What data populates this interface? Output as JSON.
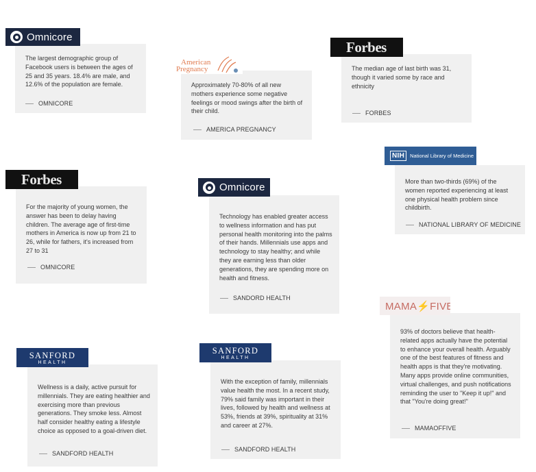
{
  "cards": [
    {
      "logo": "Omnicore",
      "text": "The largest demographic group of Facebook users is between the ages of 25 and 35 years. 18.4% are male, and 12.6% of the population are female.",
      "source": "OMNICORE"
    },
    {
      "logo_line1": "American",
      "logo_line2": "Pregnancy",
      "text": "Approximately 70-80% of all new mothers experience some negative feelings or mood swings after the birth of their child.",
      "source": "AMERICA PREGNANCY"
    },
    {
      "logo": "Forbes",
      "text": "The median age of last birth was 31, though it varied some by race and ethnicity",
      "source": "FORBES"
    },
    {
      "logo": "Forbes",
      "text": "For the majority of young women, the answer has been to delay having children. The average age of first-time mothers in America is now up from 21 to 26, while for fathers, it's increased from 27 to 31",
      "source": "OMNICORE"
    },
    {
      "logo": "Omnicore",
      "text": "Technology has enabled greater access to wellness information and has put personal health monitoring into the palms of their hands. Millennials use apps and technology to stay healthy; and while they are earning less than older generations, they are spending more on health and fitness.",
      "source": "SANDORD HEALTH"
    },
    {
      "logo_box": "NIH",
      "logo_text": "National Library of Medicine",
      "text": "More than two-thirds (69%) of the women reported experiencing at least one physical health problem since childbirth.",
      "source": "NATIONAL LIBRARY OF MEDICINE"
    },
    {
      "logo_line1": "SANFORD",
      "logo_line2": "HEALTH",
      "text": "Wellness is a daily, active pursuit for millennials. They are eating healthier and exercising more than previous generations. They smoke less. Almost half consider healthy eating a lifestyle choice as opposed to a goal-driven diet.",
      "source": "SANDFORD HEALTH"
    },
    {
      "logo_line1": "SANFORD",
      "logo_line2": "HEALTH",
      "text": "With the exception of family, millennials value health the most. In a recent study, 79% said family was important in their lives, followed by health and wellness at 53%, friends at 39%, spirituality at 31% and career at 27%.",
      "source": "SANDFORD HEALTH"
    },
    {
      "logo": "MAMA⚡FIVE",
      "text": "93% of doctors believe that health-related apps actually have the potential to enhance your overall health. Arguably one of the best features of fitness and health apps is that they're motivating. Many apps provide online communities, virtual challenges, and push notifications reminding the user to \"Keep it up!\" and that \"You're doing great!\"",
      "source": "MAMAOFFIVE"
    }
  ]
}
